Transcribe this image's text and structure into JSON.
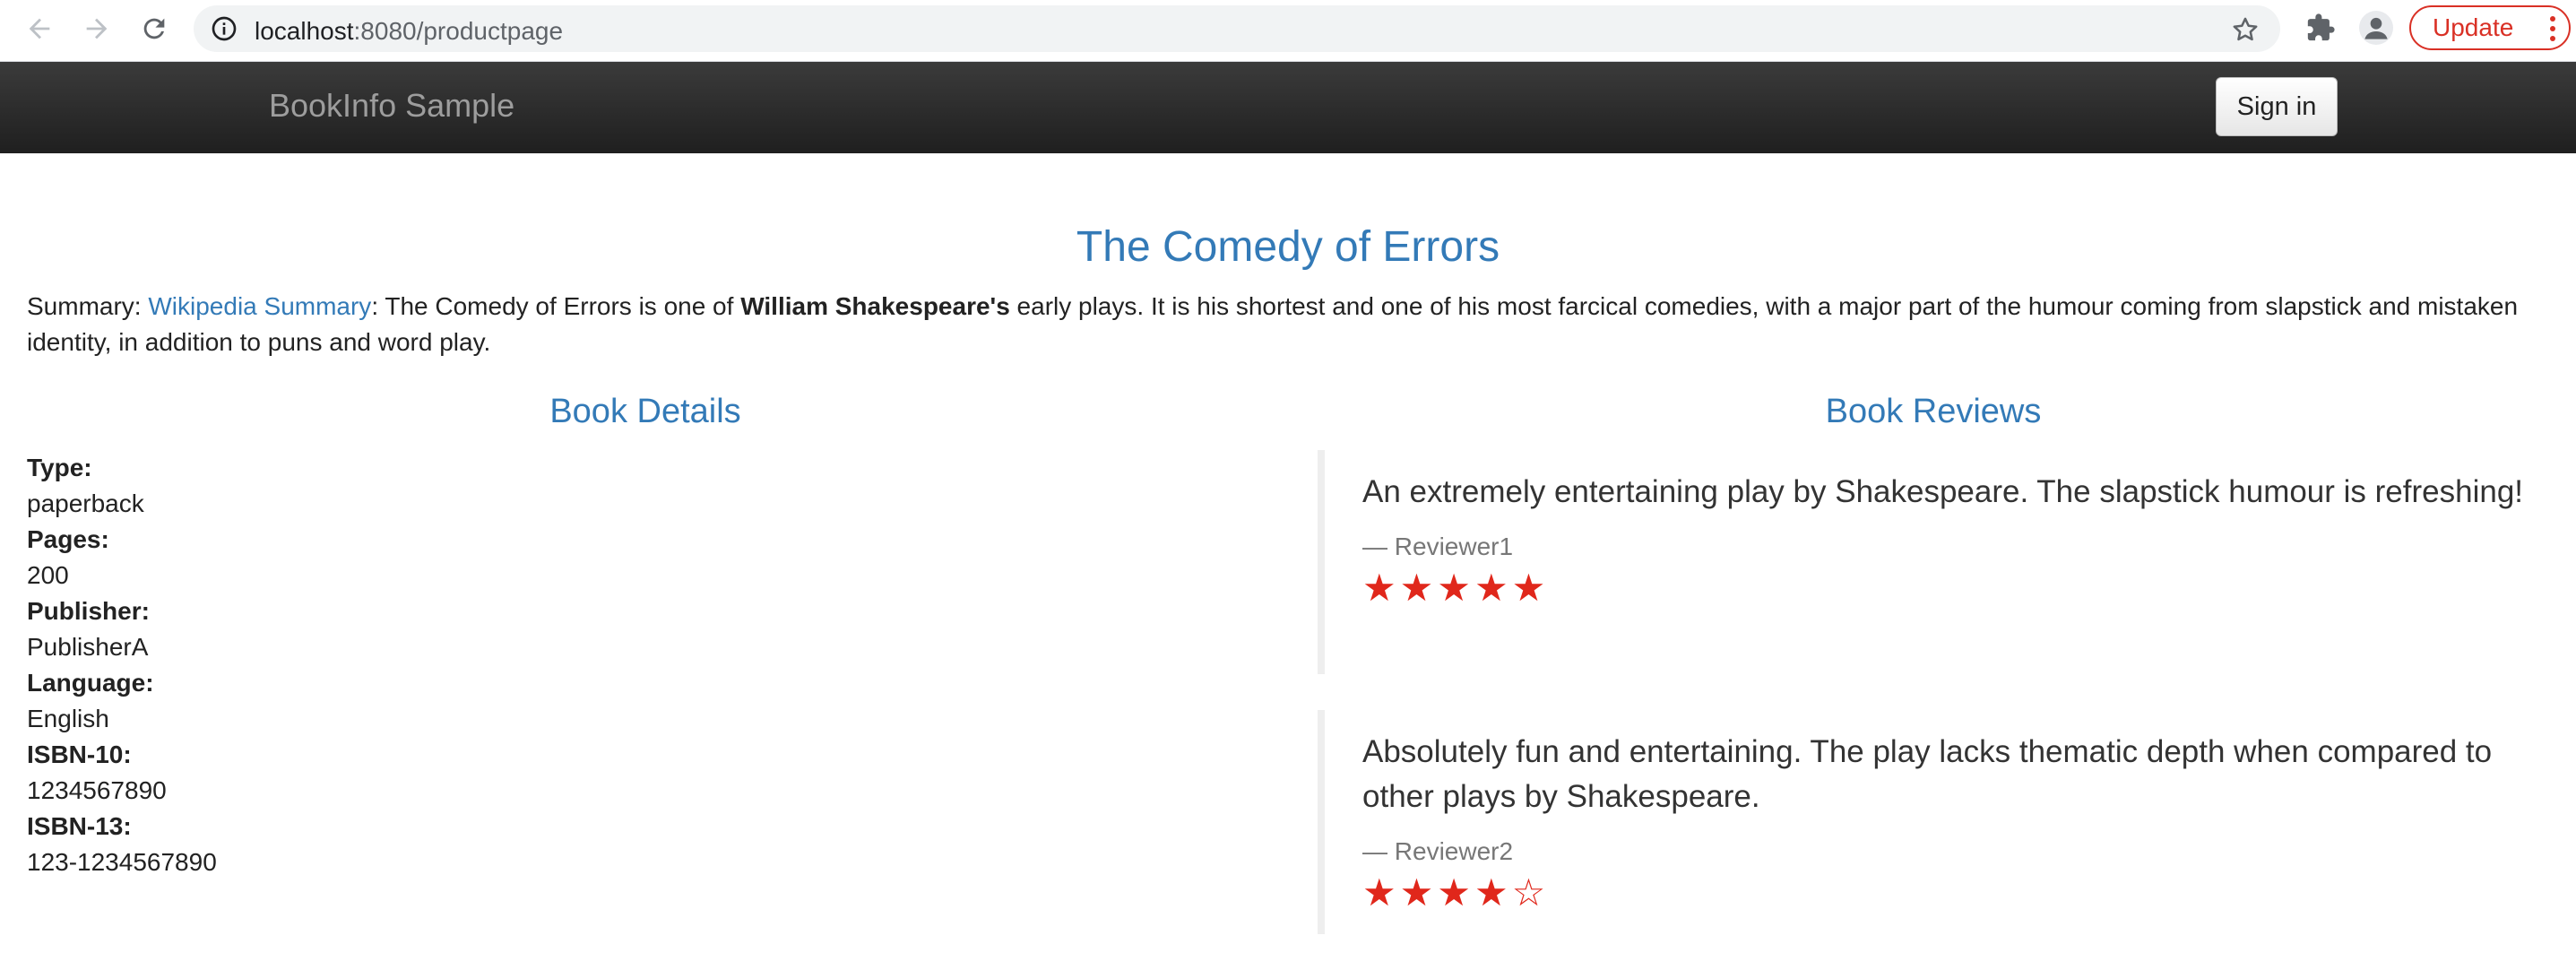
{
  "browser": {
    "url_host": "localhost",
    "url_path": ":8080/productpage",
    "update_label": "Update"
  },
  "app": {
    "brand": "BookInfo Sample",
    "signin_label": "Sign in"
  },
  "product": {
    "title": "The Comedy of Errors",
    "summary_prefix": "Summary: ",
    "summary_link": "Wikipedia Summary",
    "summary_text1": ": The Comedy of Errors is one of ",
    "summary_bold": "William Shakespeare's",
    "summary_text2": " early plays. It is his shortest and one of his most farcical comedies, with a major part of the humour coming from slapstick and mistaken identity, in addition to puns and word play."
  },
  "details": {
    "heading": "Book Details",
    "type_label": "Type:",
    "type_value": "paperback",
    "pages_label": "Pages:",
    "pages_value": "200",
    "publisher_label": "Publisher:",
    "publisher_value": "PublisherA",
    "language_label": "Language:",
    "language_value": "English",
    "isbn10_label": "ISBN-10:",
    "isbn10_value": "1234567890",
    "isbn13_label": "ISBN-13:",
    "isbn13_value": "123-1234567890"
  },
  "reviews": {
    "heading": "Book Reviews",
    "items": [
      {
        "text": "An extremely entertaining play by Shakespeare. The slapstick humour is refreshing!",
        "reviewer": "— Reviewer1",
        "stars": "★★★★★",
        "rating": 5,
        "star_color": "#e0271b"
      },
      {
        "text": "Absolutely fun and entertaining. The play lacks thematic depth when compared to other plays by Shakespeare.",
        "reviewer": "— Reviewer2",
        "stars": "★★★★☆",
        "rating": 4,
        "star_color": "#e0271b"
      }
    ]
  }
}
